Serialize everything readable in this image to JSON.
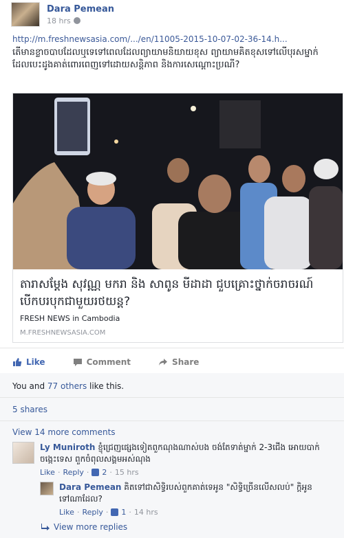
{
  "post": {
    "author": "Dara Pemean",
    "time": "18 hrs",
    "link_url": "http://m.freshnewsasia.com/.../en/11005-2015-10-07-02-36-14.h...",
    "text": "តើមានខ្លាចបាបដែលឬទេទៅពេលដែលព្យាយាមនិយាយខុស ព្យាយាមគិតខុសទៅលើបុរសម្នាក់ដែលបេះដូងគាត់ពោរពេញទៅដោយសន្តិភាព និងការសេណ្ដោះប្រណី?",
    "card": {
      "title": "តារាសម្ដែង សុវណ្ណ មករា និង សាពូន មីដាដា ជួបគ្រោះថ្នាក់ចរាចរណ៍ បើកបរបុកជាមួយរថយន្ត?",
      "source": "FRESH NEWS in Cambodia",
      "domain": "M.FRESHNEWSASIA.COM"
    }
  },
  "actions": {
    "like": "Like",
    "comment": "Comment",
    "share": "Share"
  },
  "likes": {
    "prefix": "You and ",
    "others": "77 others",
    "suffix": " like this."
  },
  "shares": "5 shares",
  "view_more_comments": "View 14 more comments",
  "comments": [
    {
      "author": "Ly Muniroth",
      "text": "ខ្ញុំជ្រេញផ្សេងទៀតពួកណុងណាស់បង ចង់តែទាត់ម្នាក់ 2-3ជើង អោយបាក់ចង្កេះទេស ពួកចំពុលសង្គមអស់ណុង",
      "like": "Like",
      "reply": "Reply",
      "likes_count": "2",
      "time": "15 hrs"
    },
    {
      "author": "Dara Pemean",
      "text": "គិតទៅជាសិទ្ធិរបស់ពួកគាត់ទេអូន \"សិទ្ធិច្រើនលើសលប់\" ក្តិអូនទៅណាដែល?",
      "like": "Like",
      "reply": "Reply",
      "likes_count": "1",
      "time": "14 hrs"
    }
  ],
  "view_more_replies": "View more replies",
  "colors": {
    "link": "#365899",
    "accent": "#4267b2",
    "muted": "#90949c"
  }
}
